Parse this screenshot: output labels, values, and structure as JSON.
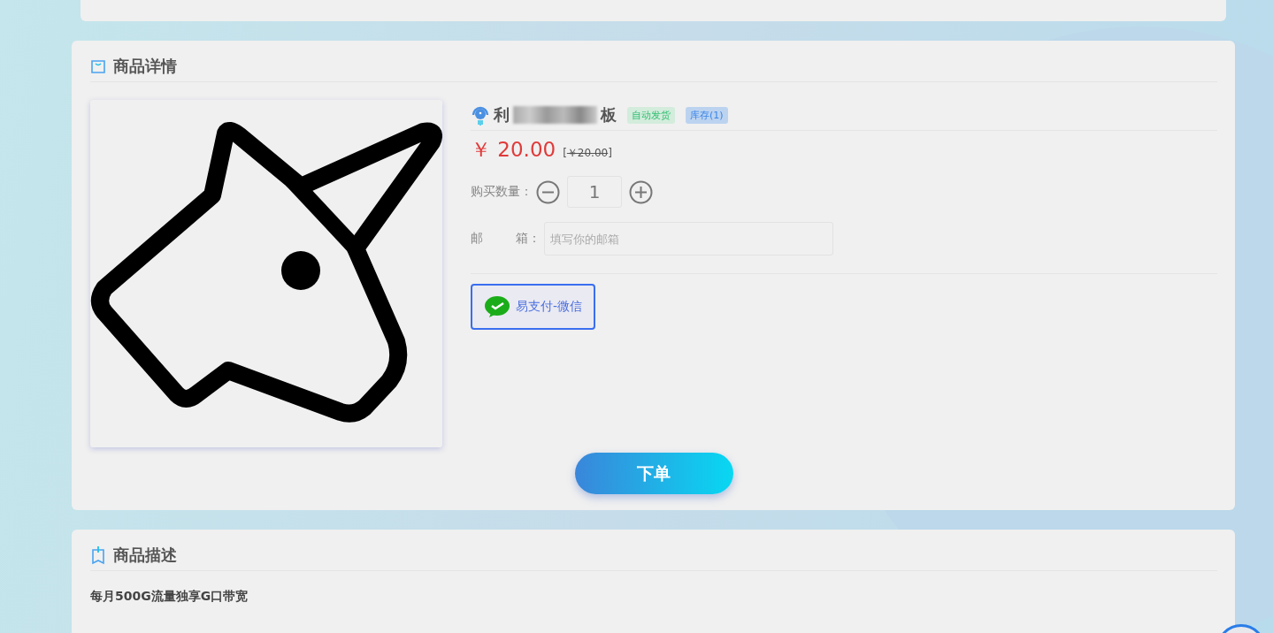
{
  "detail": {
    "heading": "商品详情",
    "product": {
      "title_visible": "利",
      "title_end": "板",
      "tags": [
        {
          "label": "自动发货",
          "color": "#d3ecdc",
          "kind": "success"
        },
        {
          "label": "库存(1)",
          "color": "#bcd3f0",
          "kind": "info"
        }
      ],
      "price": "￥ 20.00",
      "original_price": "￥20.00",
      "bracket_open": "[",
      "bracket_close": "]",
      "quantity_label": "购买数量：",
      "quantity": "1",
      "email_label_1": "邮",
      "email_label_2": "箱：",
      "email_placeholder": "填写你的邮箱",
      "payments": [
        {
          "label": "易支付-微信",
          "selected": true
        }
      ],
      "order_button": "下单"
    }
  },
  "description": {
    "heading": "商品描述",
    "text": "每月500G流量独享G口带宽"
  }
}
